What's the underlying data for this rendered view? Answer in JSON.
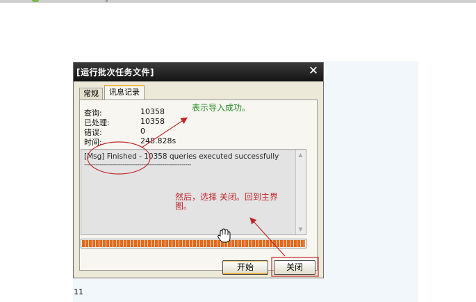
{
  "dialog": {
    "title": "[运行批次任务文件]",
    "tabs": [
      {
        "label": "常规",
        "active": false
      },
      {
        "label": "讯息记录",
        "active": true
      }
    ],
    "stats": [
      {
        "label": "查询:",
        "value": "10358"
      },
      {
        "label": "已处理:",
        "value": "10358"
      },
      {
        "label": "错误:",
        "value": "0"
      },
      {
        "label": "时间:",
        "value": "248.828s"
      }
    ],
    "log": {
      "line1": "[Msg] Finished - 10358 queries executed successfully",
      "line2": "--------------------------------------------------------"
    },
    "progress": 1.0,
    "buttons": {
      "start": "开始",
      "close": "关闭"
    }
  },
  "annotations": {
    "success": "表示导入成功。",
    "then_line1": "然后，选择 关闭。回到主界",
    "then_line2": "图。"
  },
  "page_number": "11",
  "colors": {
    "annotation_red": "#c0272d",
    "annotation_green": "#2a8f2a",
    "progress": "#e06a1f"
  },
  "icons": [
    "close-icon",
    "hand-cursor-icon"
  ]
}
